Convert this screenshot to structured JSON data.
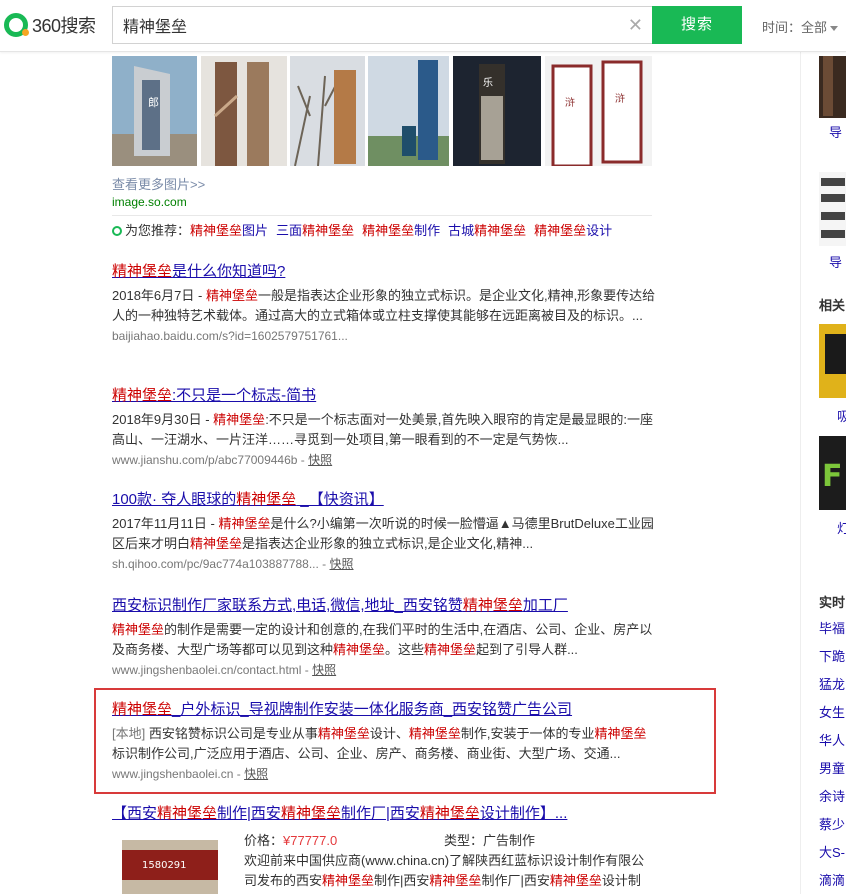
{
  "header": {
    "logo_text": "360搜索",
    "search_value": "精神堡垒",
    "clear_icon": "close-icon",
    "search_button": "搜索",
    "time_filter_label": "时间：",
    "time_filter_value": "全部",
    "brand_color": "#19b955"
  },
  "images": {
    "more_link": "查看更多图片>>",
    "source": "image.so.com"
  },
  "recommend": {
    "label": "为您推荐：",
    "items": [
      "精神堡垒图片",
      "三面精神堡垒",
      "精神堡垒制作",
      "古城精神堡垒",
      "精神堡垒设计"
    ]
  },
  "results": [
    {
      "title": "精神堡垒是什么你知道吗?",
      "desc": "2018年6月7日 - 精神堡垒一般是指表达企业形象的独立式标识。是企业文化,精神,形象要传达给人的一种独特艺术载体。通过高大的立式箱体或立柱支撑使其能够在远距离被目及的标识。...",
      "url": "baijiahao.baidu.com/s?id=1602579751761..."
    },
    {
      "title": "精神堡垒:不只是一个标志-简书",
      "desc": "2018年9月30日 - 精神堡垒:不只是一个标志面对一处美景,首先映入眼帘的肯定是最显眼的:一座高山、一汪湖水、一片汪洋……寻觅到一处项目,第一眼看到的不一定是气势恢...",
      "url": "www.jianshu.com/p/abc77009446b",
      "snapshot": "快照"
    },
    {
      "title": "100款· 夺人眼球的精神堡垒 _【快资讯】",
      "desc": "2017年11月11日 - 精神堡垒是什么?小编第一次听说的时候一脸懵逼▲马德里BrutDeluxe工业园区后来才明白精神堡垒是指表达企业形象的独立式标识,是企业文化,精神...",
      "url": "sh.qihoo.com/pc/9ac774a103887788...",
      "snapshot": "快照"
    },
    {
      "title": "西安标识制作厂家联系方式,电话,微信,地址_西安铭赞精神堡垒加工厂",
      "desc": "精神堡垒的制作是需要一定的设计和创意的,在我们平时的生活中,在酒店、公司、企业、房产以及商务楼、大型广场等都可以见到这种精神堡垒。这些精神堡垒起到了引导人群...",
      "url": "www.jingshenbaolei.cn/contact.html",
      "snapshot": "快照"
    },
    {
      "title": "精神堡垒_户外标识_导视牌制作安装一体化服务商_西安铭赞广告公司",
      "tag": "[本地]",
      "desc": "西安铭赞标识公司是专业从事精神堡垒设计、精神堡垒制作,安装于一体的专业精神堡垒标识制作公司,广泛应用于酒店、公司、企业、房产、商务楼、商业街、大型广场、交通...",
      "url": "www.jingshenbaolei.cn",
      "snapshot": "快照"
    }
  ],
  "product": {
    "title": "【西安精神堡垒制作|西安精神堡垒制作厂|西安精神堡垒设计制作】...",
    "price_label": "价格：",
    "price": "¥77777.0",
    "type_label": "类型：",
    "type": "广告制作",
    "desc_line1": "欢迎前来中国供应商(www.china.cn)了解陕西红蓝标识设计制作有限公",
    "desc_line2": "司发布的西安精神堡垒制作|西安精神堡垒制作厂|西安精神堡垒设计制"
  },
  "sidebar": {
    "link1": "导",
    "link2": "导",
    "section1": "相关",
    "link3": "吸",
    "link4": "灯",
    "section2": "实时",
    "ranks": [
      "毕福",
      "下跪",
      "猛龙",
      "女生",
      "华人",
      "男童",
      "余诗",
      "蔡少",
      "大S-",
      "滴滴"
    ]
  }
}
